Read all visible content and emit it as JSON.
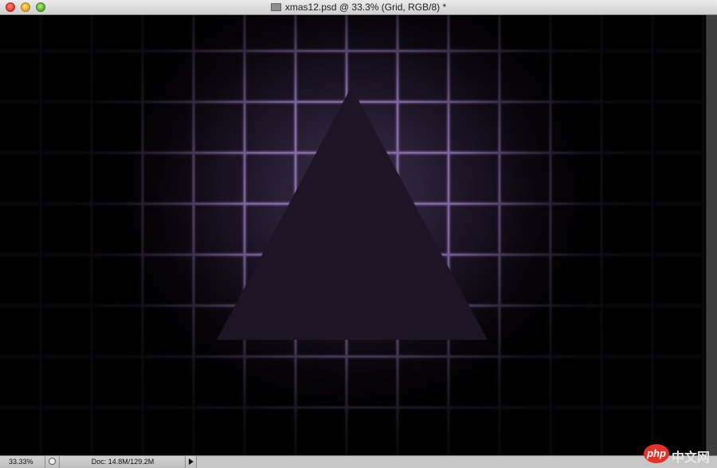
{
  "window": {
    "title": "xmas12.psd @ 33.3% (Grid, RGB/8) *"
  },
  "canvas": {
    "layer": "Grid",
    "grid_color": "#8c6fae",
    "glow_color": "#3b2b48",
    "triangle_color": "#1d1426"
  },
  "statusbar": {
    "zoom": "33.33%",
    "doc_info": "Doc: 14.8M/129.2M"
  },
  "watermark": {
    "logo": "php",
    "text": "中文网"
  }
}
